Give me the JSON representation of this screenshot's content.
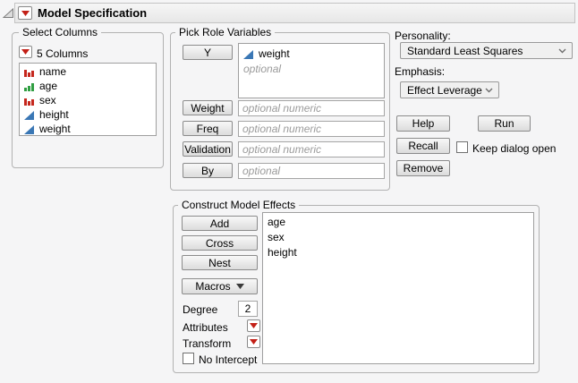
{
  "header": {
    "title": "Model Specification"
  },
  "select_columns": {
    "legend": "Select Columns",
    "count_label": "5 Columns",
    "columns": [
      {
        "name": "name",
        "type": "nominal"
      },
      {
        "name": "age",
        "type": "ordinal"
      },
      {
        "name": "sex",
        "type": "nominal"
      },
      {
        "name": "height",
        "type": "continuous"
      },
      {
        "name": "weight",
        "type": "continuous"
      }
    ]
  },
  "pick_roles": {
    "legend": "Pick Role Variables",
    "y": {
      "button": "Y",
      "assigned": [
        {
          "name": "weight",
          "type": "continuous"
        }
      ],
      "placeholder": "optional"
    },
    "rows": [
      {
        "button": "Weight",
        "placeholder": "optional numeric"
      },
      {
        "button": "Freq",
        "placeholder": "optional numeric"
      },
      {
        "button": "Validation",
        "placeholder": "optional numeric"
      },
      {
        "button": "By",
        "placeholder": "optional"
      }
    ]
  },
  "personality": {
    "label": "Personality:",
    "value": "Standard Least Squares"
  },
  "emphasis": {
    "label": "Emphasis:",
    "value": "Effect Leverage"
  },
  "actions": {
    "help": "Help",
    "run": "Run",
    "recall": "Recall",
    "remove": "Remove",
    "keep_dialog_open": "Keep dialog open",
    "keep_dialog_checked": false
  },
  "construct_effects": {
    "legend": "Construct Model Effects",
    "add": "Add",
    "cross": "Cross",
    "nest": "Nest",
    "macros": "Macros",
    "degree_label": "Degree",
    "degree_value": "2",
    "attributes_label": "Attributes",
    "transform_label": "Transform",
    "no_intercept_label": "No Intercept",
    "effects": [
      "age",
      "sex",
      "height"
    ]
  },
  "colors": {
    "accent_red": "#c32017",
    "continuous_blue": "#3a77b5",
    "ordinal_green": "#2f9e41",
    "nominal_red": "#c5271d"
  }
}
